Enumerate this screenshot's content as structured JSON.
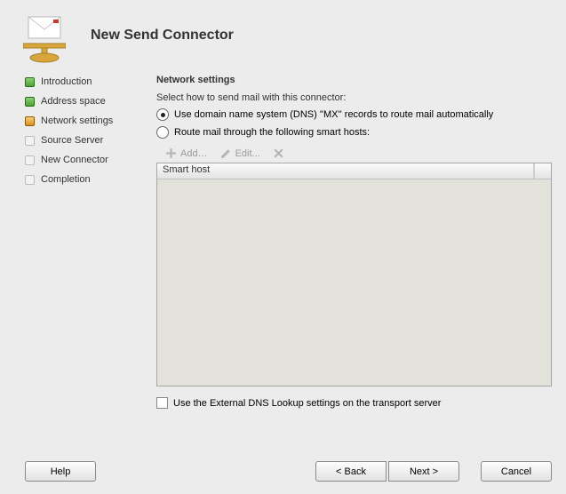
{
  "header": {
    "title": "New Send Connector"
  },
  "sidebar": {
    "items": [
      {
        "label": "Introduction",
        "state": "done"
      },
      {
        "label": "Address space",
        "state": "done"
      },
      {
        "label": "Network settings",
        "state": "active"
      },
      {
        "label": "Source Server",
        "state": "todo"
      },
      {
        "label": "New Connector",
        "state": "todo"
      },
      {
        "label": "Completion",
        "state": "todo"
      }
    ]
  },
  "content": {
    "title": "Network settings",
    "sub": "Select how to send mail with this connector:",
    "radio_dns": "Use domain name system (DNS) ''MX'' records to route mail automatically",
    "radio_sh": "Route mail through the following smart hosts:",
    "radio_selected": "dns",
    "toolbar": {
      "add": "Add…",
      "edit": "Edit...",
      "remove": ""
    },
    "list": {
      "columns": [
        "Smart host"
      ],
      "rows": []
    },
    "ext_dns_label": "Use the External DNS Lookup settings on the transport server",
    "ext_dns_checked": false
  },
  "footer": {
    "help": "Help",
    "back": "< Back",
    "next": "Next >",
    "cancel": "Cancel"
  }
}
